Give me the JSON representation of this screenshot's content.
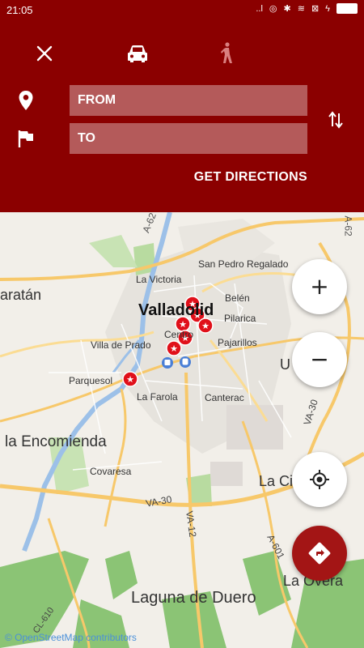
{
  "status": {
    "time": "21:05",
    "battery_icon": "battery-icon"
  },
  "header": {
    "close_icon": "close-icon",
    "car_icon": "car-icon",
    "walk_icon": "walk-icon",
    "from_placeholder": "FROM",
    "to_placeholder": "TO",
    "swap_icon": "swap-icon",
    "get_directions": "GET DIRECTIONS"
  },
  "map": {
    "labels": {
      "a62_top": "A-62",
      "a62_right": "A-62",
      "san_pedro": "San Pedro Regalado",
      "la_victoria": "La Victoria",
      "valladolid": "Valladolid",
      "belen": "Belén",
      "pilarica": "Pilarica",
      "aratan": "aratán",
      "centro": "Centro",
      "pajarillos": "Pajarillos",
      "villa_prado": "Villa de Prado",
      "parquesol": "Parquesol",
      "la_farola": "La Farola",
      "canterac": "Canterac",
      "u_right": "U",
      "encomienda": "la Encomienda",
      "covaresa": "Covaresa",
      "la_cistérniga": "La Cistérniga",
      "va30_left": "VA-30",
      "va30_right": "VA-30",
      "va12": "VA-12",
      "a601": "A-601",
      "la_overa": "La Overa",
      "laguna": "Laguna de Duero",
      "cl610": "CL-610"
    },
    "attribution": "© OpenStreetMap contributors"
  },
  "controls": {
    "zoom_in": "+",
    "zoom_out": "−",
    "locate_icon": "my-location-icon",
    "directions_icon": "directions-icon"
  },
  "colors": {
    "header": "#8b0000",
    "field": "#b45a5a",
    "marker": "#e0101a",
    "fab_red": "#a31515",
    "road": "#f7c86a",
    "water": "#9cc0e8",
    "park": "#b8dba0"
  }
}
